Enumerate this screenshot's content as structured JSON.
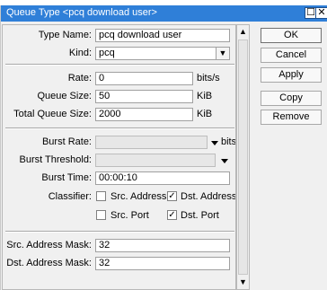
{
  "window": {
    "title": "Queue Type <pcq download user>",
    "maximize_glyph": "☐",
    "close_glyph": "✕"
  },
  "form": {
    "type_name_label": "Type Name:",
    "type_name_value": "pcq download user",
    "kind_label": "Kind:",
    "kind_value": "pcq",
    "rate_label": "Rate:",
    "rate_value": "0",
    "rate_unit": "bits/s",
    "queue_size_label": "Queue Size:",
    "queue_size_value": "50",
    "queue_size_unit": "KiB",
    "total_queue_size_label": "Total Queue Size:",
    "total_queue_size_value": "2000",
    "total_queue_size_unit": "KiB",
    "burst_rate_label": "Burst Rate:",
    "burst_rate_value": "",
    "burst_rate_unit": "bits/s",
    "burst_threshold_label": "Burst Threshold:",
    "burst_threshold_value": "",
    "burst_time_label": "Burst Time:",
    "burst_time_value": "00:00:10",
    "classifier_label": "Classifier:",
    "classifier": {
      "src_address": {
        "label": "Src. Address",
        "checked": false
      },
      "dst_address": {
        "label": "Dst. Address",
        "checked": true
      },
      "src_port": {
        "label": "Src. Port",
        "checked": false
      },
      "dst_port": {
        "label": "Dst. Port",
        "checked": true
      }
    },
    "src_address_mask_label": "Src. Address Mask:",
    "src_address_mask_value": "32",
    "dst_address_mask_label": "Dst. Address Mask:",
    "dst_address_mask_value": "32"
  },
  "buttons": {
    "ok": "OK",
    "cancel": "Cancel",
    "apply": "Apply",
    "copy": "Copy",
    "remove": "Remove"
  },
  "icons": {
    "dropdown": "dropdown-arrow-icon",
    "scroll_up": "scroll-up-arrow-icon",
    "scroll_down": "scroll-down-arrow-icon",
    "check": "checkmark-icon"
  },
  "colors": {
    "titlebar": "#2f7fd8",
    "window_bg": "#f0f0f0",
    "field_bg": "#ffffff",
    "disabled_field_bg": "#e7e7e7"
  }
}
